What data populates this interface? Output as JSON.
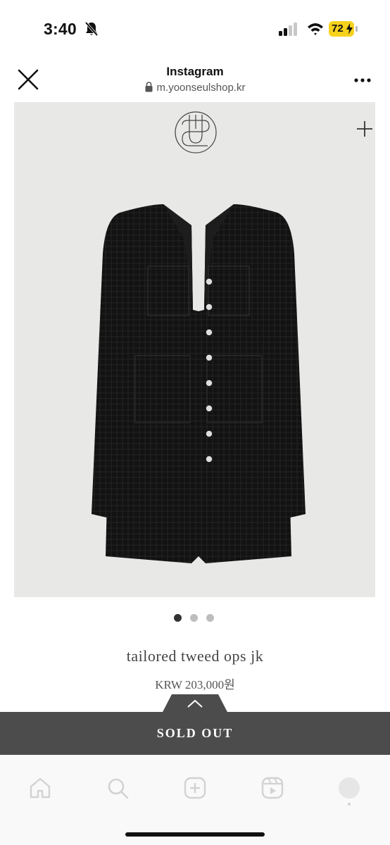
{
  "status_bar": {
    "time": "3:40",
    "battery": "72",
    "battery_color": "#f7d21c",
    "icons": [
      "bell-slash-icon",
      "signal-icon",
      "wifi-icon",
      "battery-icon"
    ]
  },
  "browser": {
    "title": "Instagram",
    "url": "m.yoonseulshop.kr",
    "icons": [
      "close-icon",
      "lock-icon",
      "more-icon"
    ]
  },
  "product": {
    "name": "tailored tweed ops jk",
    "price": "KRW 203,000원",
    "image_count": 3,
    "active_image": 1,
    "icons": [
      "brand-logo-icon",
      "plus-icon",
      "chevron-up-icon"
    ]
  },
  "purchase": {
    "sold_out_label": "SOLD OUT",
    "bar_color": "#4c4c4c"
  },
  "bottom_nav": {
    "items": [
      "home-icon",
      "search-icon",
      "create-icon",
      "reels-icon",
      "profile-avatar"
    ]
  }
}
